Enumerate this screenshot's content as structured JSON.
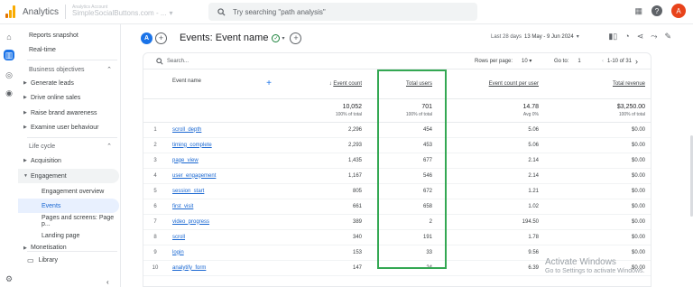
{
  "app": {
    "name": "Analytics",
    "account_line1": "Analytics Account",
    "account_line2": "SimpleSocialButtons.com - ...",
    "search_placeholder": "Try searching \"path analysis\"",
    "avatar_letter": "A",
    "brand_colors": {
      "logo_orange": "#f9ab00",
      "logo_dark": "#e37400",
      "accent": "#1a73e8",
      "highlight": "#34a853"
    }
  },
  "sidebar": {
    "top_items": [
      "Reports snapshot",
      "Real-time"
    ],
    "sections": [
      {
        "title": "Business objectives",
        "items": [
          "Generate leads",
          "Drive online sales",
          "Raise brand awareness",
          "Examine user behaviour"
        ]
      },
      {
        "title": "Life cycle",
        "items": [
          "Acquisition",
          "Engagement"
        ],
        "engagement_children": [
          "Engagement overview",
          "Events",
          "Pages and screens: Page p...",
          "Landing page"
        ],
        "after": "Monetisation"
      }
    ],
    "library": "Library"
  },
  "header": {
    "compare_chip": "A",
    "title": "Events: Event name",
    "date_label": "Last 28 days",
    "date_range": "13 May - 9 Jun 2024"
  },
  "table": {
    "search_placeholder": "Search...",
    "rows_per_page_label": "Rows per page:",
    "rows_per_page": "10",
    "goto_label": "Go to:",
    "goto_value": "1",
    "pager_text": "1-10 of 31",
    "columns": [
      "Event name",
      "Event count",
      "Total users",
      "Event count per user",
      "Total revenue"
    ],
    "totals": {
      "event_count": "10,052",
      "event_count_sub": "100% of total",
      "total_users": "701",
      "total_users_sub": "100% of total",
      "per_user": "14.78",
      "per_user_sub": "Avg 0%",
      "revenue": "$3,250.00",
      "revenue_sub": "100% of total"
    },
    "rows": [
      {
        "i": "1",
        "name": "scroll_depth",
        "count": "2,296",
        "users": "454",
        "per": "5.06",
        "rev": "$0.00"
      },
      {
        "i": "2",
        "name": "timing_complete",
        "count": "2,293",
        "users": "453",
        "per": "5.06",
        "rev": "$0.00"
      },
      {
        "i": "3",
        "name": "page_view",
        "count": "1,435",
        "users": "677",
        "per": "2.14",
        "rev": "$0.00"
      },
      {
        "i": "4",
        "name": "user_engagement",
        "count": "1,167",
        "users": "546",
        "per": "2.14",
        "rev": "$0.00"
      },
      {
        "i": "5",
        "name": "session_start",
        "count": "805",
        "users": "672",
        "per": "1.21",
        "rev": "$0.00"
      },
      {
        "i": "6",
        "name": "first_visit",
        "count": "661",
        "users": "658",
        "per": "1.02",
        "rev": "$0.00"
      },
      {
        "i": "7",
        "name": "video_progress",
        "count": "389",
        "users": "2",
        "per": "194.50",
        "rev": "$0.00"
      },
      {
        "i": "8",
        "name": "scroll",
        "count": "340",
        "users": "191",
        "per": "1.78",
        "rev": "$0.00"
      },
      {
        "i": "9",
        "name": "login",
        "count": "153",
        "users": "33",
        "per": "9.56",
        "rev": "$0.00"
      },
      {
        "i": "10",
        "name": "analytify_form",
        "count": "147",
        "users": "24",
        "per": "6.39",
        "rev": "$0.00"
      }
    ]
  },
  "watermark": {
    "line1": "Activate Windows",
    "line2": "Go to Settings to activate Windows."
  }
}
